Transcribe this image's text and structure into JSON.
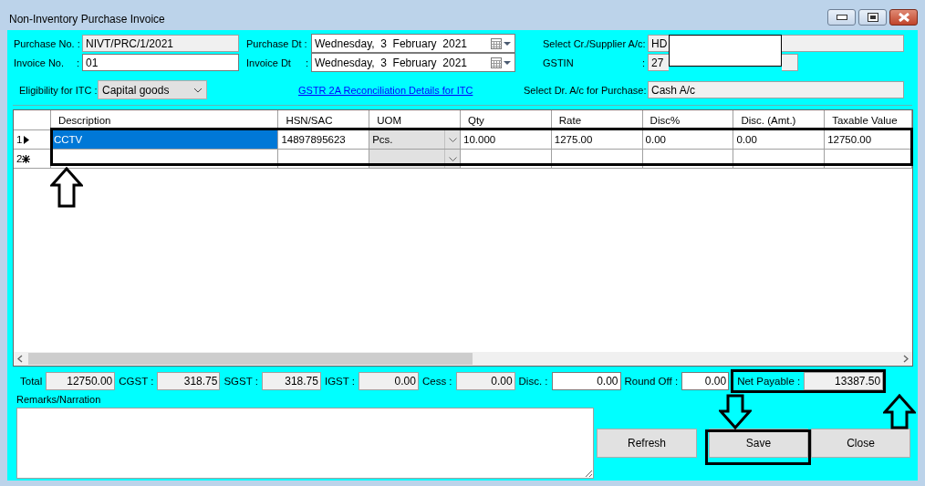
{
  "window": {
    "title": "Non-Inventory Purchase Invoice"
  },
  "header_rows": [
    [
      {
        "kind": "text",
        "label": "Purchase No. :",
        "value": "NIVT/PRC/1/2021",
        "read_only": true
      },
      {
        "kind": "date",
        "label": "Purchase Dt :",
        "value": "Wednesday,  3  February  2021"
      },
      {
        "kind": "text",
        "label": "Select Cr./Supplier A/c",
        "colon": ":",
        "value": "HD",
        "read_only": true
      }
    ],
    [
      {
        "kind": "text",
        "label": "Invoice No.",
        "colon": ":",
        "value": "01",
        "read_only": false
      },
      {
        "kind": "date",
        "label": "Invoice Dt",
        "colon": ":",
        "value": "Wednesday,  3  February  2021"
      },
      {
        "kind": "text",
        "label": "GSTIN",
        "colon": ":",
        "value": "27",
        "read_only": true
      }
    ],
    [
      {
        "kind": "combo",
        "label": "Eligibility for ITC :",
        "value": "Capital goods"
      },
      {
        "kind": "link",
        "text": "GSTR 2A Reconciliation Details for ITC"
      },
      {
        "kind": "text",
        "label": "Select Dr. A/c for Purchase",
        "colon": ":",
        "value": "Cash A/c",
        "read_only": true
      }
    ]
  ],
  "grid": {
    "columns": [
      {
        "label": "Description",
        "kind": "text"
      },
      {
        "label": "HSN/SAC",
        "kind": "text"
      },
      {
        "label": "UOM",
        "kind": "combo"
      },
      {
        "label": "Qty",
        "kind": "text"
      },
      {
        "label": "Rate",
        "kind": "text"
      },
      {
        "label": "Disc%",
        "kind": "text"
      },
      {
        "label": "Disc. (Amt.)",
        "kind": "text"
      },
      {
        "label": "Taxable Value",
        "kind": "text"
      }
    ],
    "rows": [
      {
        "number": "1",
        "kind": "current",
        "selected": true,
        "cells": [
          "CCTV",
          "14897895623",
          "Pcs.",
          "10.000",
          "1275.00",
          "0.00",
          "0.00",
          "12750.00"
        ]
      },
      {
        "number": "2",
        "kind": "new",
        "selected": false
      }
    ]
  },
  "totals": [
    {
      "label": "Total",
      "value": "12750.00",
      "read_only": true
    },
    {
      "label": "CGST :",
      "value": "318.75",
      "read_only": true
    },
    {
      "label": "SGST :",
      "value": "318.75",
      "read_only": true
    },
    {
      "label": "IGST :",
      "value": "0.00",
      "read_only": true
    },
    {
      "label": "Cess :",
      "value": "0.00",
      "read_only": true
    },
    {
      "label": "Disc. :",
      "value": "0.00",
      "read_only": false
    },
    {
      "label": "Round Off :",
      "value": "0.00",
      "read_only": false
    },
    {
      "label": "Net Payable :",
      "value": "13387.50",
      "read_only": true
    }
  ],
  "remarks": {
    "label": "Remarks/Narration"
  },
  "buttons": [
    "Refresh",
    "Save",
    "Close"
  ]
}
